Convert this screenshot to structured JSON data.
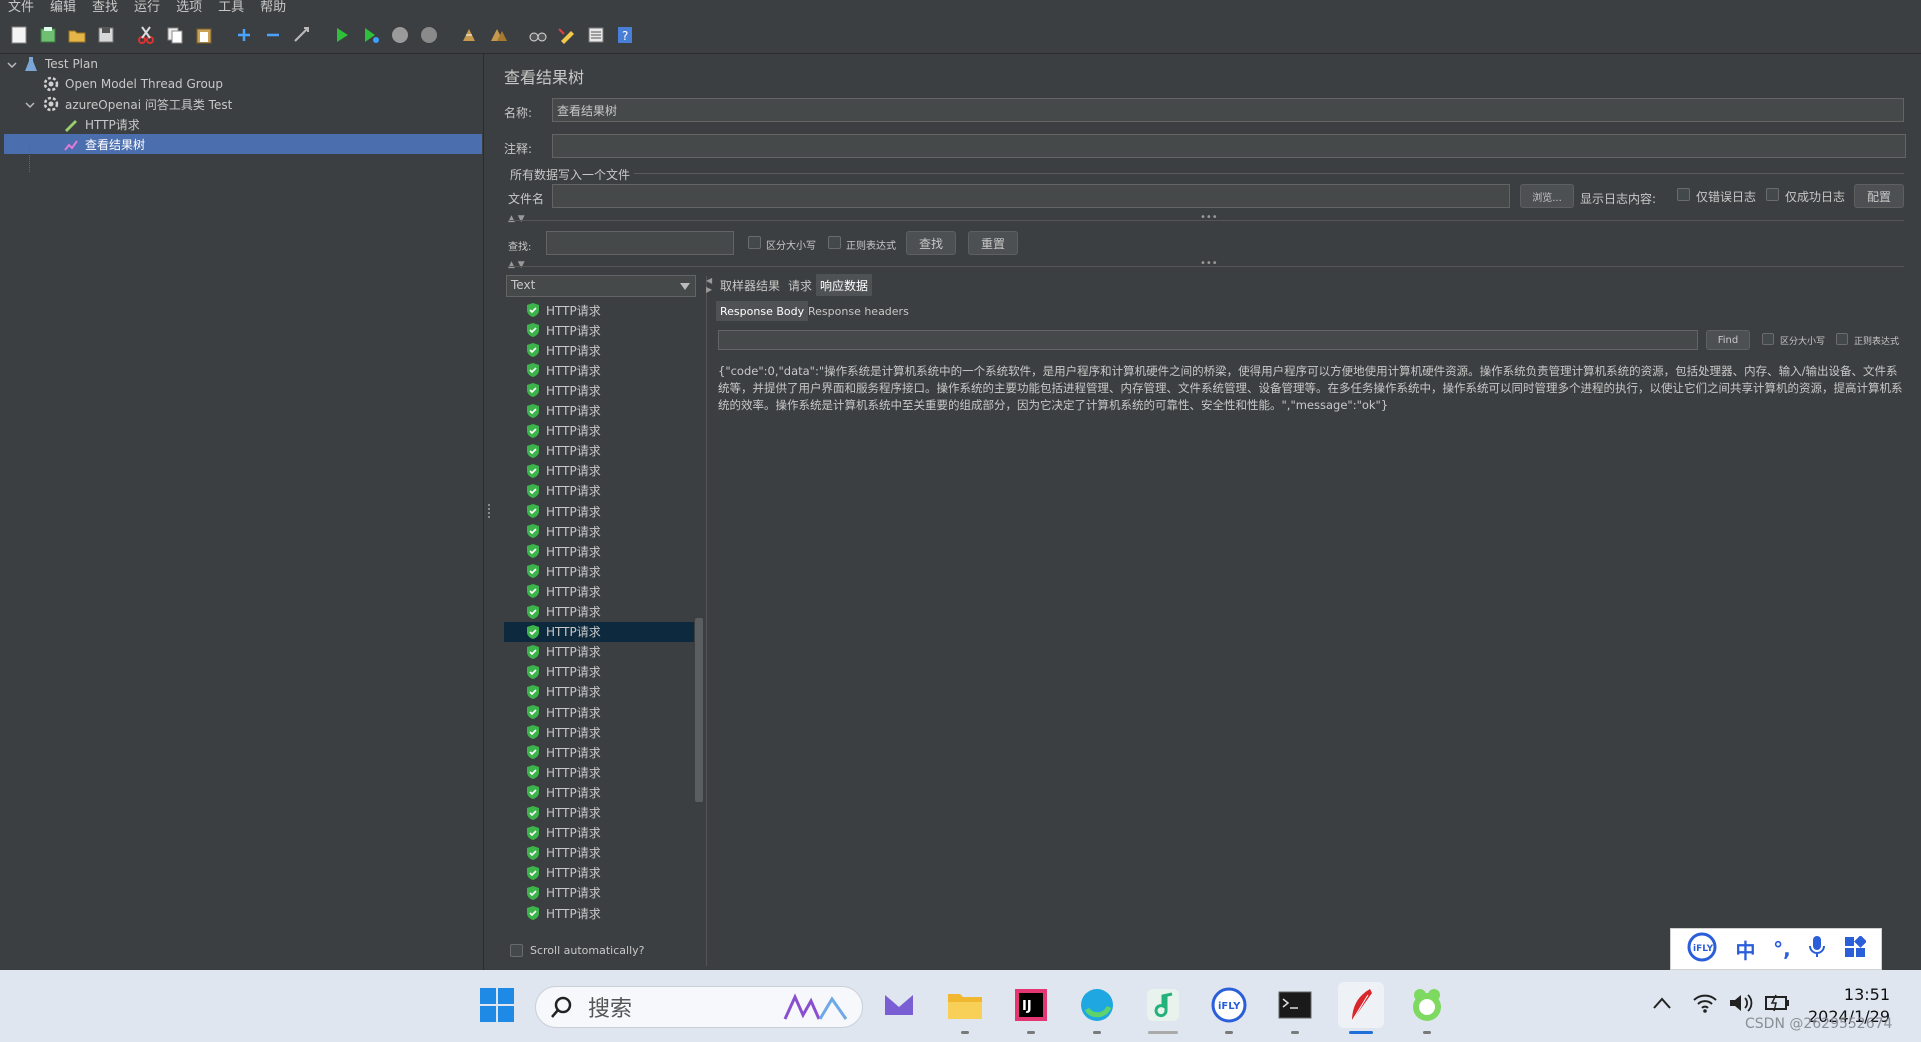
{
  "menu": [
    "文件",
    "编辑",
    "查找",
    "运行",
    "选项",
    "工具",
    "帮助"
  ],
  "tree": {
    "items": [
      {
        "label": "Test Plan"
      },
      {
        "label": "Open Model Thread Group"
      },
      {
        "label": "azureOpenai 问答工具类 Test"
      },
      {
        "label": "HTTP请求"
      },
      {
        "label": "查看结果树"
      }
    ]
  },
  "panel": {
    "title": "查看结果树",
    "name_label": "名称:",
    "name_value": "查看结果树",
    "comment_label": "注释:",
    "comment_value": "",
    "file_section": "所有数据写入一个文件",
    "file_label": "文件名",
    "file_value": "",
    "browse_button": "浏览...",
    "log_display_label": "显示日志内容:",
    "errors_only": "仅错误日志",
    "success_only": "仅成功日志",
    "configure_button": "配置",
    "search_label": "查找:",
    "search_value": "",
    "case_sensitive": "区分大小写",
    "regex": "正则表达式",
    "find_button": "查找",
    "reset_button": "重置"
  },
  "renderer": {
    "selected": "Text"
  },
  "samples": {
    "label": "HTTP请求",
    "count": 32,
    "selected_index": 16,
    "scroll_auto": "Scroll automatically?"
  },
  "tabs": [
    "取样器结果",
    "请求",
    "响应数据"
  ],
  "active_tab": 2,
  "subtabs": [
    "Response Body",
    "Response headers"
  ],
  "response_search": {
    "find_button": "Find",
    "case_sensitive": "区分大小写",
    "regex": "正则表达式"
  },
  "response_body": "{\"code\":0,\"data\":\"操作系统是计算机系统中的一个系统软件，是用户程序和计算机硬件之间的桥梁，使得用户程序可以方便地使用计算机硬件资源。操作系统负责管理计算机系统的资源，包括处理器、内存、输入/输出设备、文件系统等，并提供了用户界面和服务程序接口。操作系统的主要功能包括进程管理、内存管理、文件系统管理、设备管理等。在多任务操作系统中，操作系统可以同时管理多个进程的执行，以使让它们之间共享计算机的资源，提高计算机系统的效率。操作系统是计算机系统中至关重要的组成部分，因为它决定了计算机系统的可靠性、安全性和性能。\",\"message\":\"ok\"}",
  "taskbar": {
    "search_text": "搜索",
    "time": "13:51",
    "date": "2024/1/29",
    "watermark": "CSDN @2629552674"
  },
  "ime": [
    "iFLY",
    "中",
    "°,",
    "mic",
    "grid"
  ],
  "colors": {
    "accent": "#4b6eaf",
    "shield_green": "#3cb44b"
  }
}
